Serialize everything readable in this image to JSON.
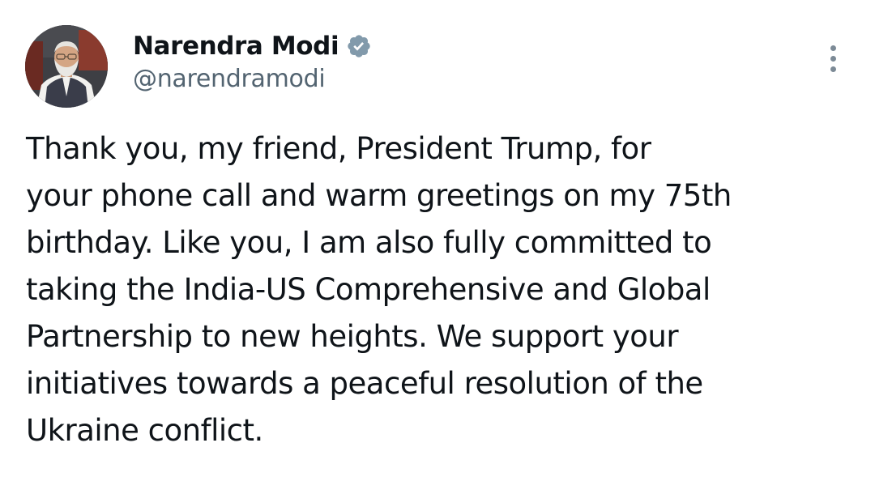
{
  "author": {
    "display_name": "Narendra Modi",
    "handle": "@narendramodi",
    "verified": true,
    "verified_color": "#829aab"
  },
  "avatar": {
    "icon": "profile-photo"
  },
  "menu": {
    "icon": "more-vertical-icon"
  },
  "tweet": {
    "lines": [
      "Thank you, my friend, President Trump, for",
      "your phone call and warm greetings on my 75th",
      "birthday. Like you, I am also fully committed to",
      "taking the India-US Comprehensive and Global",
      "Partnership to new heights. We support your",
      "initiatives towards a peaceful resolution of the",
      "Ukraine conflict."
    ]
  },
  "colors": {
    "text": "#0f1419",
    "secondary_text": "#536471",
    "background": "#ffffff"
  }
}
